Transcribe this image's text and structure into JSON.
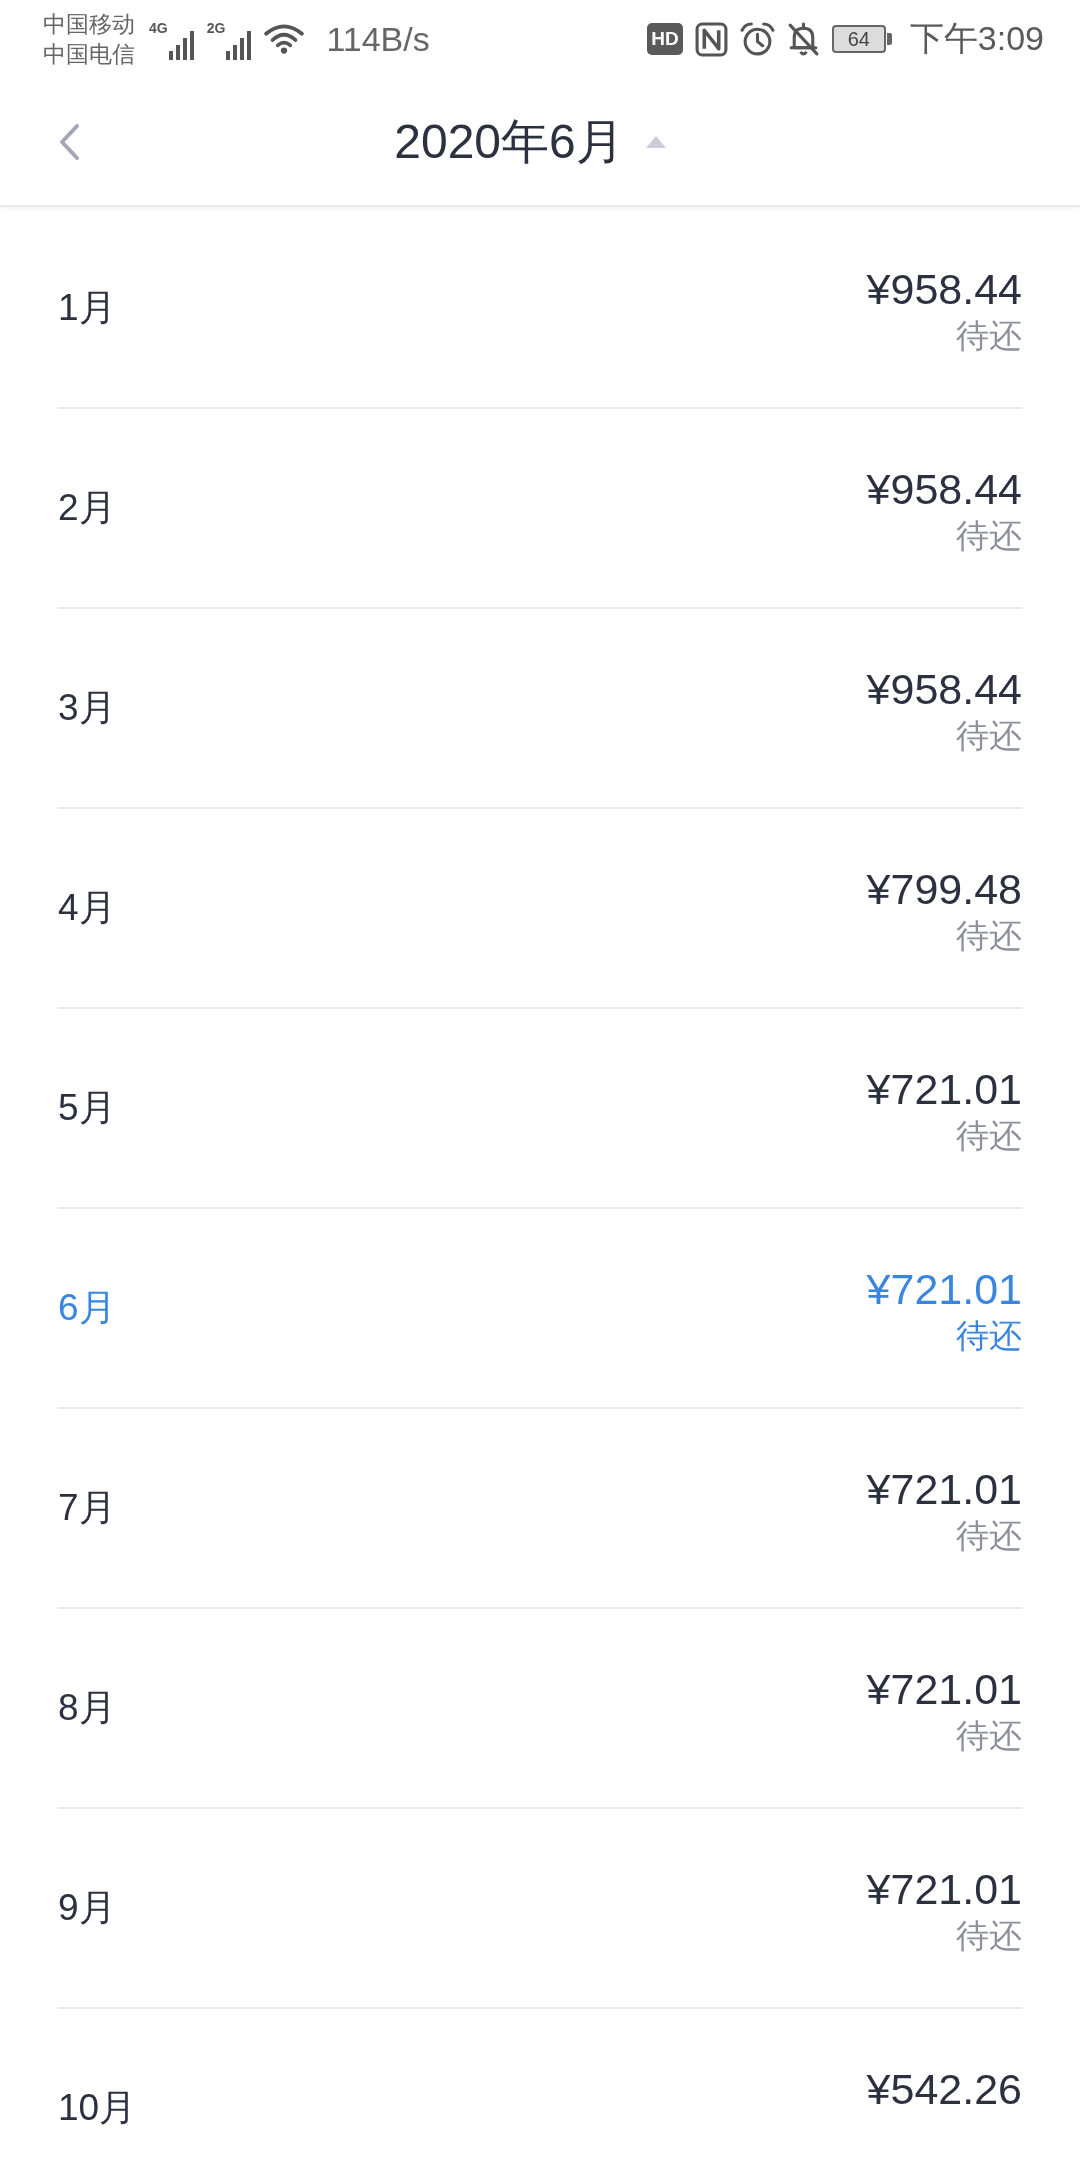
{
  "status_bar": {
    "carriers": [
      "中国移动",
      "中国电信"
    ],
    "signals": [
      {
        "label": "4G"
      },
      {
        "label": "2G"
      }
    ],
    "speed": "114B/s",
    "hd": "HD",
    "battery": "64",
    "time": "下午3:09"
  },
  "header": {
    "title": "2020年6月"
  },
  "rows": [
    {
      "month": "1月",
      "amount": "¥958.44",
      "status": "待还",
      "selected": false
    },
    {
      "month": "2月",
      "amount": "¥958.44",
      "status": "待还",
      "selected": false
    },
    {
      "month": "3月",
      "amount": "¥958.44",
      "status": "待还",
      "selected": false
    },
    {
      "month": "4月",
      "amount": "¥799.48",
      "status": "待还",
      "selected": false
    },
    {
      "month": "5月",
      "amount": "¥721.01",
      "status": "待还",
      "selected": false
    },
    {
      "month": "6月",
      "amount": "¥721.01",
      "status": "待还",
      "selected": true
    },
    {
      "month": "7月",
      "amount": "¥721.01",
      "status": "待还",
      "selected": false
    },
    {
      "month": "8月",
      "amount": "¥721.01",
      "status": "待还",
      "selected": false
    },
    {
      "month": "9月",
      "amount": "¥721.01",
      "status": "待还",
      "selected": false
    },
    {
      "month": "10月",
      "amount": "¥542.26",
      "selected": false
    }
  ]
}
